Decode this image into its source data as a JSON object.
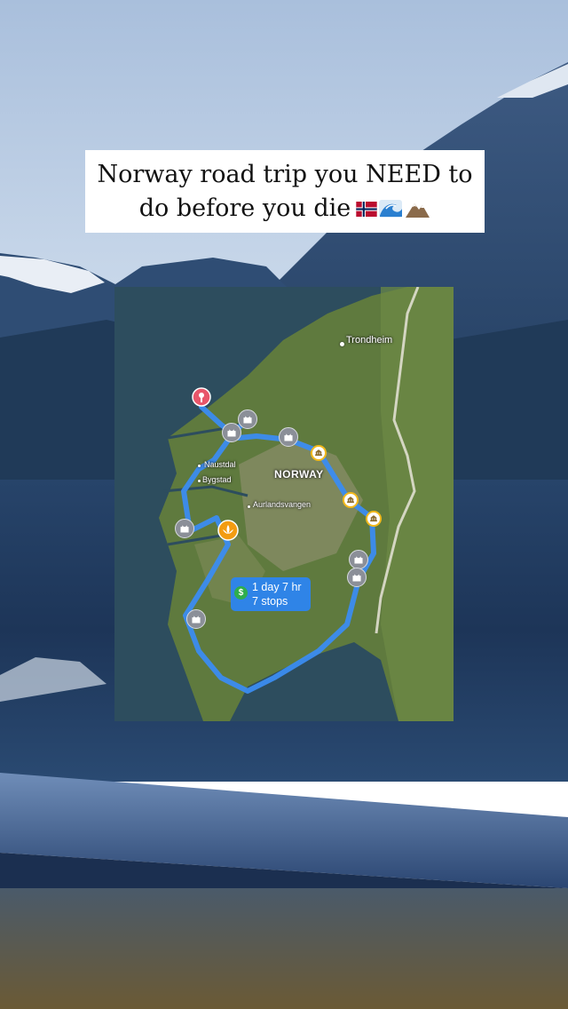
{
  "caption": {
    "line1": "Norway road trip you NEED to",
    "line2": "do before you die"
  },
  "icons": [
    "norway-flag-icon",
    "wave-icon",
    "mountain-icon",
    "pin-icon",
    "castle-icon",
    "lotus-icon",
    "museum-icon",
    "money-icon"
  ],
  "map": {
    "labels": {
      "trondheim": "Trondheim",
      "naustdal": "Naustdal",
      "bygstad": "Bygstad",
      "norway": "NORWAY",
      "aurlandsvangen": "Aurlandsvangen"
    },
    "route": {
      "duration": "1 day 7 hr",
      "stops": "7 stops",
      "currency_symbol": "$"
    }
  },
  "colors": {
    "route": "#3b8cf0",
    "pin": "#e8566a",
    "lotus": "#f39c12",
    "caption_bg": "#ffffff"
  }
}
